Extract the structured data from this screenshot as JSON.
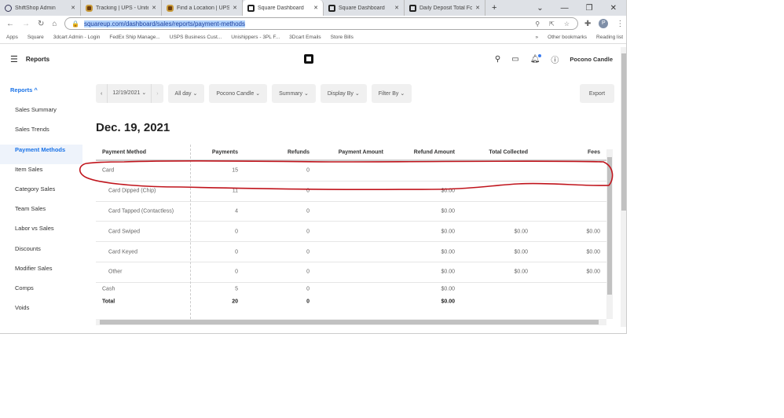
{
  "browser": {
    "tabs": [
      {
        "title": "ShiftShop Admin",
        "icon": "shipstation-icon"
      },
      {
        "title": "Tracking | UPS - Unite",
        "icon": "ups-icon"
      },
      {
        "title": "Find a Location | UPS",
        "icon": "ups-icon"
      },
      {
        "title": "Square Dashboard",
        "icon": "square-icon",
        "active": true
      },
      {
        "title": "Square Dashboard",
        "icon": "square-icon"
      },
      {
        "title": "Daily Deposit Total Fo",
        "icon": "square-icon"
      }
    ],
    "url_prefix": "",
    "url": "squareup.com/dashboard/sales/reports/payment-methods",
    "profile_initial": "P",
    "bookmarks": [
      "Apps",
      "Square",
      "3dcart Admin - Login",
      "FedEx Ship Manage...",
      "USPS Business Cust...",
      "Unishippers - 3PL F...",
      "3Dcart Emails",
      "Store Bills"
    ],
    "bookmarks_right": [
      "Other bookmarks",
      "Reading list"
    ]
  },
  "header": {
    "title": "Reports",
    "account": "Pocono Candle"
  },
  "sidebar": {
    "section": "Reports ^",
    "items": [
      "Sales Summary",
      "Sales Trends",
      "Payment Methods",
      "Item Sales",
      "Category Sales",
      "Team Sales",
      "Labor vs Sales",
      "Discounts",
      "Modifier Sales",
      "Comps",
      "Voids"
    ],
    "active": "Payment Methods"
  },
  "filters": {
    "date": "12/19/2021 ⌄",
    "time": "All day ⌄",
    "location": "Pocono Candle ⌄",
    "summary": "Summary ⌄",
    "display": "Display By ⌄",
    "filter": "Filter By ⌄",
    "export": "Export"
  },
  "report_date": "Dec. 19, 2021",
  "table": {
    "columns": [
      "Payment Method",
      "Payments",
      "Refunds",
      "Payment Amount",
      "Refund Amount",
      "Total Collected",
      "Fees"
    ],
    "rows": [
      {
        "method": "Card",
        "payments": "15",
        "refunds": "0",
        "payment_amount": "",
        "refund_amount": "",
        "total_collected": "",
        "fees": ""
      },
      {
        "method": "Card Dipped (Chip)",
        "payments": "11",
        "refunds": "0",
        "payment_amount": "",
        "refund_amount": "$0.00",
        "total_collected": "",
        "fees": ""
      },
      {
        "method": "Card Tapped (Contactless)",
        "payments": "4",
        "refunds": "0",
        "payment_amount": "",
        "refund_amount": "$0.00",
        "total_collected": "",
        "fees": ""
      },
      {
        "method": "Card Swiped",
        "payments": "0",
        "refunds": "0",
        "payment_amount": "",
        "refund_amount": "$0.00",
        "total_collected": "$0.00",
        "fees": "$0.00"
      },
      {
        "method": "Card Keyed",
        "payments": "0",
        "refunds": "0",
        "payment_amount": "",
        "refund_amount": "$0.00",
        "total_collected": "$0.00",
        "fees": "$0.00"
      },
      {
        "method": "Other",
        "payments": "0",
        "refunds": "0",
        "payment_amount": "",
        "refund_amount": "$0.00",
        "total_collected": "$0.00",
        "fees": "$0.00"
      },
      {
        "method": "Cash",
        "payments": "5",
        "refunds": "0",
        "payment_amount": "",
        "refund_amount": "$0.00",
        "total_collected": "",
        "fees": ""
      }
    ],
    "total": {
      "method": "Total",
      "payments": "20",
      "refunds": "0",
      "payment_amount": "",
      "refund_amount": "$0.00",
      "total_collected": "",
      "fees": ""
    }
  },
  "annotation_color": "#c0141c"
}
